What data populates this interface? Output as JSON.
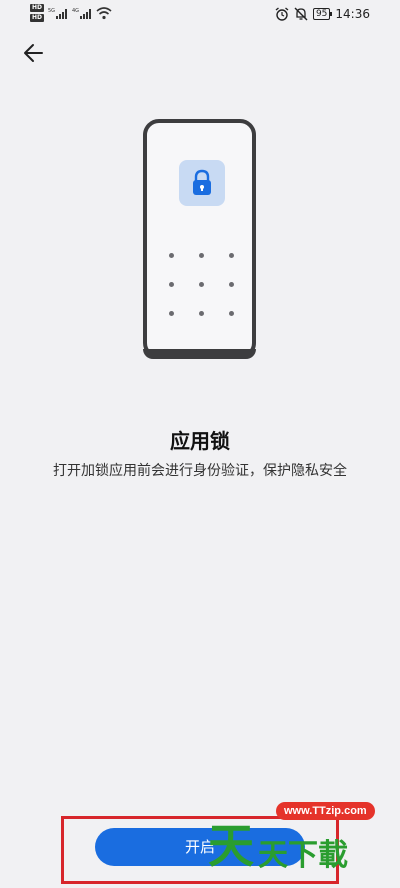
{
  "status_bar": {
    "left": {
      "hd1": "HD",
      "hd2": "HD",
      "net1": "5G",
      "net2": "4G"
    },
    "battery": "95",
    "time": "14:36",
    "icons": [
      "alarm-icon",
      "mute-icon"
    ]
  },
  "nav": {
    "back_icon": "arrow-left-icon"
  },
  "illustration": {
    "phone_icon": "lock-icon",
    "pattern_dots": 9
  },
  "content": {
    "title": "应用锁",
    "description": "打开加锁应用前会进行身份验证，保护隐私安全"
  },
  "action": {
    "open_label": "开启"
  },
  "watermark": {
    "url": "www.TTzip.com",
    "text_big": "天",
    "text_small": "天下載"
  },
  "colors": {
    "accent": "#1a6de0",
    "highlight": "#d7262b",
    "watermark_green": "#2a9d2f"
  }
}
